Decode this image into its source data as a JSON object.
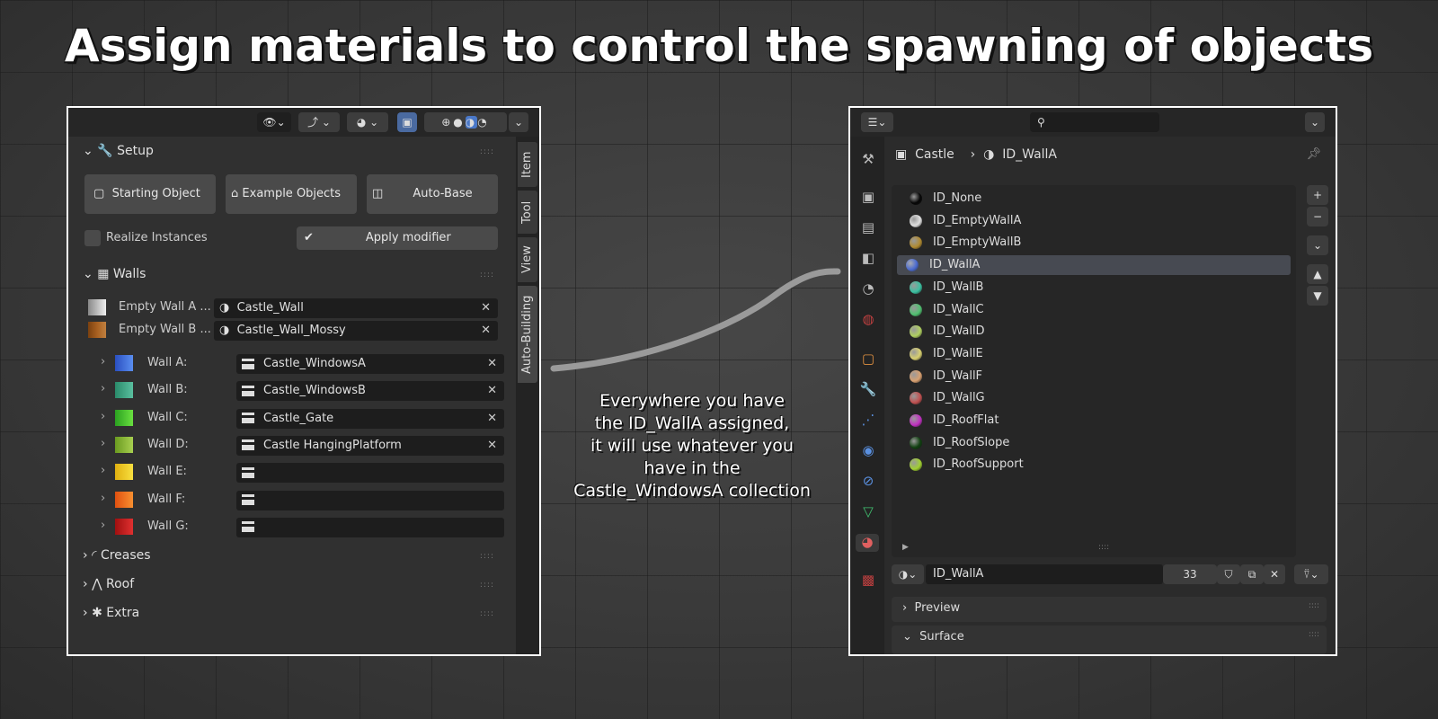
{
  "title": "Assign materials to control the spawning of objects",
  "left_panel": {
    "setup": {
      "label": "Setup",
      "buttons": [
        "Starting Object",
        "Example Objects",
        "Auto-Base"
      ],
      "realize_label": "Realize Instances",
      "realize_checked": false,
      "apply_label": "Apply modifier",
      "apply_checked": true
    },
    "walls": {
      "label": "Walls",
      "empty": [
        {
          "label": "Empty Wall A ...",
          "value": "Castle_Wall"
        },
        {
          "label": "Empty Wall B ...",
          "value": "Castle_Wall_Mossy"
        }
      ],
      "rows": [
        {
          "label": "Wall A:",
          "value": "Castle_WindowsA",
          "colors": [
            "#2a4fc0",
            "#5a8ef0"
          ]
        },
        {
          "label": "Wall B:",
          "value": "Castle_WindowsB",
          "colors": [
            "#2a8a6a",
            "#5ac0a0"
          ]
        },
        {
          "label": "Wall C:",
          "value": "Castle_Gate",
          "colors": [
            "#2aa020",
            "#6ae040"
          ]
        },
        {
          "label": "Wall D:",
          "value": "Castle HangingPlatform",
          "colors": [
            "#6a9a20",
            "#a8d050"
          ]
        },
        {
          "label": "Wall E:",
          "value": "",
          "colors": [
            "#e0b010",
            "#f8e040"
          ]
        },
        {
          "label": "Wall F:",
          "value": "",
          "colors": [
            "#e05010",
            "#f89030"
          ]
        },
        {
          "label": "Wall G:",
          "value": "",
          "colors": [
            "#a01010",
            "#e03030"
          ]
        }
      ]
    },
    "other_sections": [
      "Creases",
      "Roof",
      "Extra"
    ],
    "tabs": [
      "Item",
      "Tool",
      "View",
      "Auto-Building"
    ]
  },
  "annotation": [
    "Everywhere you have",
    "the ID_WallA assigned,",
    "it will use whatever you",
    "have in the",
    "Castle_WindowsA collection"
  ],
  "right_panel": {
    "breadcrumb": {
      "object": "Castle",
      "material": "ID_WallA"
    },
    "materials": [
      {
        "name": "ID_None",
        "color": "#050505"
      },
      {
        "name": "ID_EmptyWallA",
        "color": "#e0e0e0"
      },
      {
        "name": "ID_EmptyWallB",
        "color": "#b08a30"
      },
      {
        "name": "ID_WallA",
        "color": "#4a6ad0",
        "selected": true
      },
      {
        "name": "ID_WallB",
        "color": "#3ac0a0"
      },
      {
        "name": "ID_WallC",
        "color": "#50c070"
      },
      {
        "name": "ID_WallD",
        "color": "#b0d060"
      },
      {
        "name": "ID_WallE",
        "color": "#d8d070"
      },
      {
        "name": "ID_WallF",
        "color": "#d8a070"
      },
      {
        "name": "ID_WallG",
        "color": "#c05050"
      },
      {
        "name": "ID_RoofFlat",
        "color": "#c030c0"
      },
      {
        "name": "ID_RoofSlope",
        "color": "#104010"
      },
      {
        "name": "ID_RoofSupport",
        "color": "#a0d030"
      }
    ],
    "material_field": "ID_WallA",
    "users": "33",
    "sections": [
      "Preview",
      "Surface"
    ]
  }
}
